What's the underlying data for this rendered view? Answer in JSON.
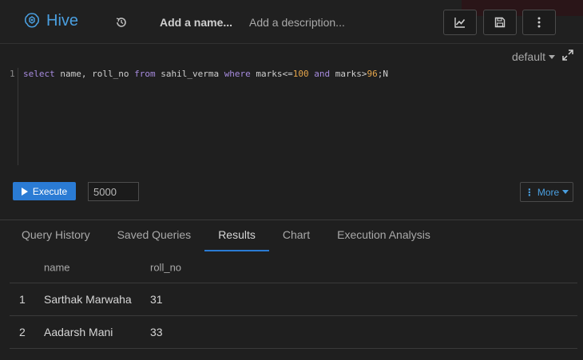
{
  "header": {
    "app_title": "Hive",
    "name_placeholder": "Add a name...",
    "description_placeholder": "Add a description...",
    "icons": [
      "hive-logo-icon",
      "history-icon",
      "chart-icon",
      "save-icon",
      "more-vertical-icon"
    ]
  },
  "editor": {
    "database": "default",
    "line_number": "1",
    "query": {
      "t1": "select",
      "t2": " name, roll_no ",
      "t3": "from",
      "t4": " sahil_verma ",
      "t5": "where",
      "t6": " marks<=",
      "t7": "100",
      "t8": " ",
      "t9": "and",
      "t10": " marks>",
      "t11": "96",
      "t12": ";N"
    }
  },
  "actions": {
    "execute_label": "Execute",
    "limit_value": "5000",
    "more_label": "More"
  },
  "tabs": [
    {
      "label": "Query History"
    },
    {
      "label": "Saved Queries"
    },
    {
      "label": "Results",
      "active": true
    },
    {
      "label": "Chart"
    },
    {
      "label": "Execution Analysis"
    }
  ],
  "results": {
    "columns": [
      "name",
      "roll_no"
    ],
    "rows": [
      {
        "index": "1",
        "name": "Sarthak Marwaha",
        "roll_no": "31"
      },
      {
        "index": "2",
        "name": "Aadarsh Mani",
        "roll_no": "33"
      }
    ]
  },
  "colors": {
    "accent": "#2a7bd4",
    "brand": "#4a9fe0",
    "background": "#1f1f1f"
  }
}
